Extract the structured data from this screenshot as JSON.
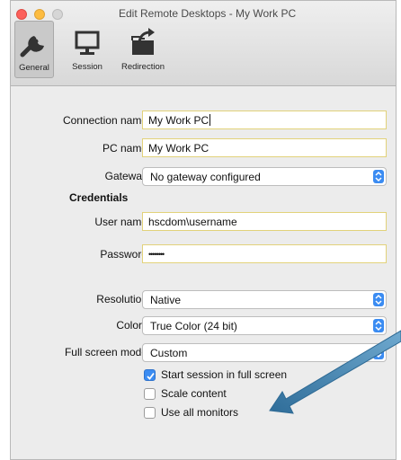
{
  "window": {
    "title": "Edit Remote Desktops - My Work PC"
  },
  "toolbar": {
    "general": "General",
    "session": "Session",
    "redirection": "Redirection"
  },
  "form": {
    "connection_name": {
      "label": "Connection name",
      "value": "My Work PC"
    },
    "pc_name": {
      "label": "PC name",
      "value": "My Work PC"
    },
    "gateway": {
      "label": "Gateway",
      "value": "No gateway configured"
    },
    "credentials_heading": "Credentials",
    "user_name": {
      "label": "User name",
      "value": "hscdom\\username"
    },
    "password": {
      "label": "Password",
      "value": "••••••••"
    },
    "resolution": {
      "label": "Resolution",
      "value": "Native"
    },
    "colors": {
      "label": "Colors",
      "value": "True Color (24 bit)"
    },
    "full_screen_mode": {
      "label": "Full screen mode",
      "value": "Custom"
    },
    "start_full_screen": {
      "label": "Start session in full screen",
      "checked": true
    },
    "scale_content": {
      "label": "Scale content",
      "checked": false
    },
    "use_all_monitors": {
      "label": "Use all monitors",
      "checked": false
    }
  },
  "colors": {
    "accent": "#3b8cf2",
    "field_border": "#e2d27a",
    "arrow": "#3a7fae"
  }
}
